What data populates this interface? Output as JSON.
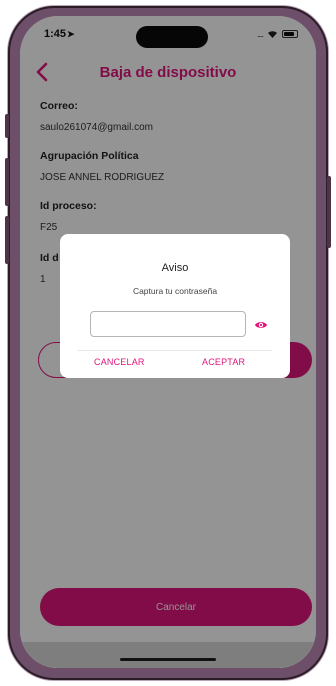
{
  "status_bar": {
    "time": "1:45",
    "location_arrow": "➤",
    "signal": "....",
    "icons": [
      "location-arrow-icon",
      "wifi-icon",
      "battery-icon"
    ]
  },
  "nav": {
    "back_icon": "chevron-left-icon",
    "title": "Baja de dispositivo"
  },
  "fields": [
    {
      "label": "Correo:",
      "value": "saulo261074@gmail.com"
    },
    {
      "label": "Agrupación Política",
      "value": "JOSE ANNEL RODRIGUEZ"
    },
    {
      "label": "Id proceso:",
      "value": "F25"
    },
    {
      "label": "Id d",
      "value": "1"
    }
  ],
  "buttons": {
    "cancel_main": "Cancelar"
  },
  "dialog": {
    "title": "Aviso",
    "message": "Captura tu contraseña",
    "password_value": "",
    "reveal_icon": "eye-icon",
    "cancel_label": "CANCELAR",
    "accept_label": "ACEPTAR"
  },
  "colors": {
    "accent": "#e0157b",
    "overlay": "rgba(0,0,0,0.42)",
    "frame": "#6e4f6a"
  }
}
